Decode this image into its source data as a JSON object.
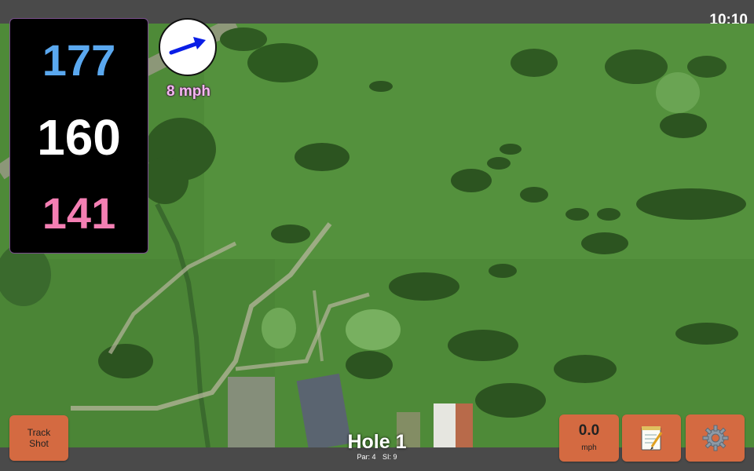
{
  "status_bar": {
    "time": "10:10"
  },
  "distances": {
    "back": "177",
    "center": "160",
    "front": "141"
  },
  "wind": {
    "speed": "8 mph",
    "icon": "wind-arrow-icon"
  },
  "controls": {
    "track_shot": "Track\nShot",
    "speed_value": "0.0",
    "speed_unit": "mph",
    "notes_icon": "notepad-icon",
    "settings_icon": "gear-icon"
  },
  "hole": {
    "title": "Hole 1",
    "par": "Par: 4",
    "si": "SI: 9"
  },
  "colors": {
    "back": "#5aa8ef",
    "center": "#ffffff",
    "front": "#f47fb3",
    "button": "#d46a41"
  }
}
